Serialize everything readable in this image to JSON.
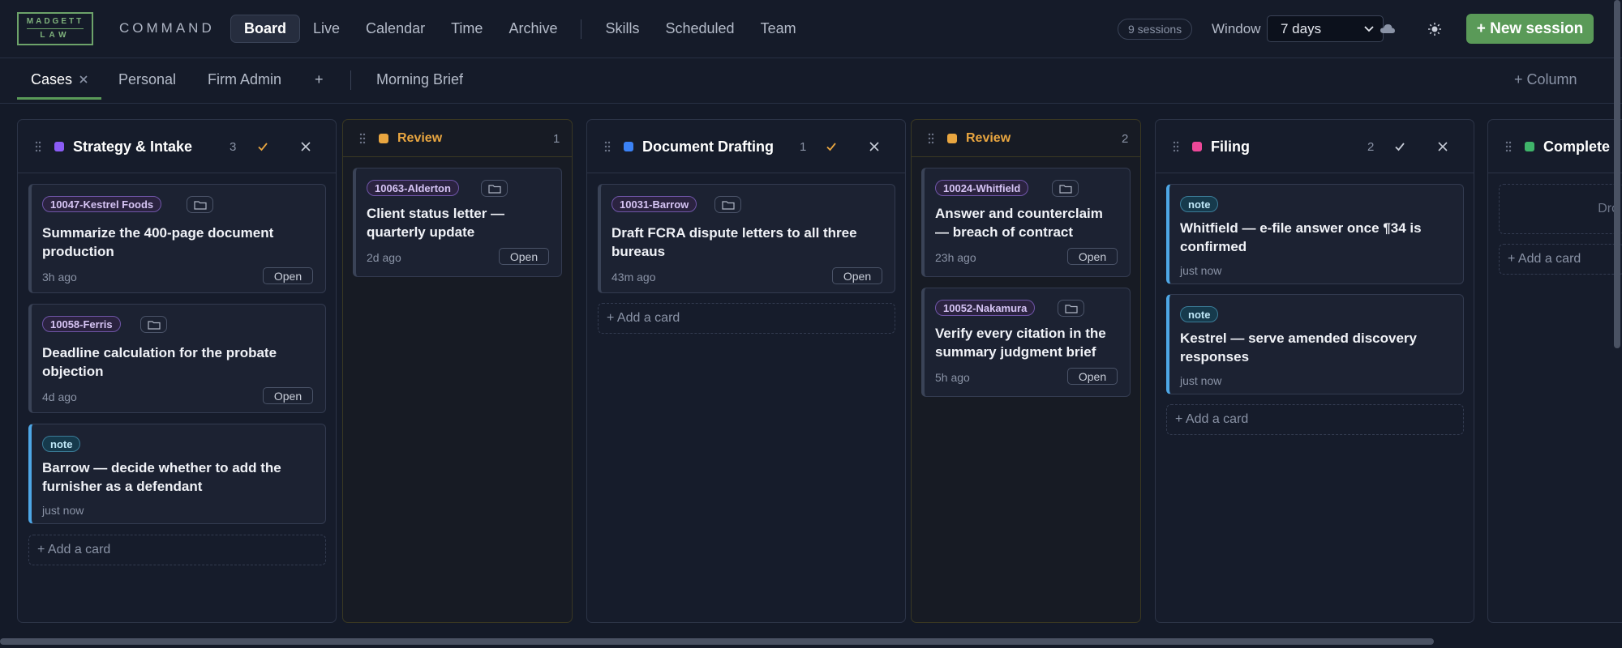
{
  "logo": {
    "line1": "MADGETT",
    "line2": "LAW"
  },
  "app": {
    "name": "COMMAND"
  },
  "nav": {
    "items": [
      "Board",
      "Live",
      "Calendar",
      "Time",
      "Archive"
    ],
    "items2": [
      "Skills",
      "Scheduled",
      "Team"
    ],
    "active": "Board"
  },
  "toolbar": {
    "sessions": "9 sessions",
    "window_label": "Window",
    "window_value": "7 days",
    "new_session": "+ New session",
    "icons": [
      "cloud-icon",
      "sun-icon"
    ]
  },
  "tabs": {
    "items": [
      "Cases",
      "Personal",
      "Firm Admin",
      "+",
      "Morning Brief"
    ],
    "active": "Cases",
    "add_column": "+ Column"
  },
  "colors": {
    "accent": "#5a9a58",
    "tag_purple": "#6f55a8",
    "note_blue": "#4ea7e6",
    "review_amber": "#e9a640"
  },
  "columns": [
    {
      "title": "Strategy & Intake",
      "count": "3",
      "dot_color": "#8b5cf6",
      "cards": [
        {
          "tag": "10047-Kestrel Foods",
          "title": "Summarize the 400-page document production",
          "time": "3h ago",
          "open": "Open"
        },
        {
          "tag": "10058-Ferris",
          "title": "Deadline calculation for the probate objection",
          "time": "4d ago",
          "open": "Open"
        },
        {
          "tag": "note",
          "title": "Barrow — decide whether to add the furnisher as a defendant",
          "time": "just now"
        }
      ],
      "add_card": "+ Add a card"
    },
    {
      "title": "Review",
      "count": "1",
      "dot_color": "#e9a640",
      "cards": [
        {
          "tag": "10063-Alderton",
          "title": "Client status letter — quarterly update",
          "time": "2d ago",
          "open": "Open"
        }
      ]
    },
    {
      "title": "Document Drafting",
      "count": "1",
      "dot_color": "#3b82f6",
      "cards": [
        {
          "tag": "10031-Barrow",
          "title": "Draft FCRA dispute letters to all three bureaus",
          "time": "43m ago",
          "open": "Open"
        }
      ],
      "add_card": "+ Add a card"
    },
    {
      "title": "Review",
      "count": "2",
      "dot_color": "#e9a640",
      "cards": [
        {
          "tag": "10024-Whitfield",
          "title": "Answer and counterclaim — breach of contract",
          "time": "23h ago",
          "open": "Open"
        },
        {
          "tag": "10052-Nakamura",
          "title": "Verify every citation in the summary judgment brief",
          "time": "5h ago",
          "open": "Open"
        }
      ]
    },
    {
      "title": "Filing",
      "count": "2",
      "dot_color": "#ec4899",
      "cards": [
        {
          "tag": "note",
          "title": "Whitfield — e-file answer once ¶34 is confirmed",
          "time": "just now"
        },
        {
          "tag": "note",
          "title": "Kestrel — serve amended discovery responses",
          "time": "just now"
        }
      ],
      "add_card": "+ Add a card"
    },
    {
      "title": "Complete",
      "dot_color": "#3fb46a",
      "drop_hint": "Dro",
      "add_card": "+ Add a card"
    }
  ]
}
